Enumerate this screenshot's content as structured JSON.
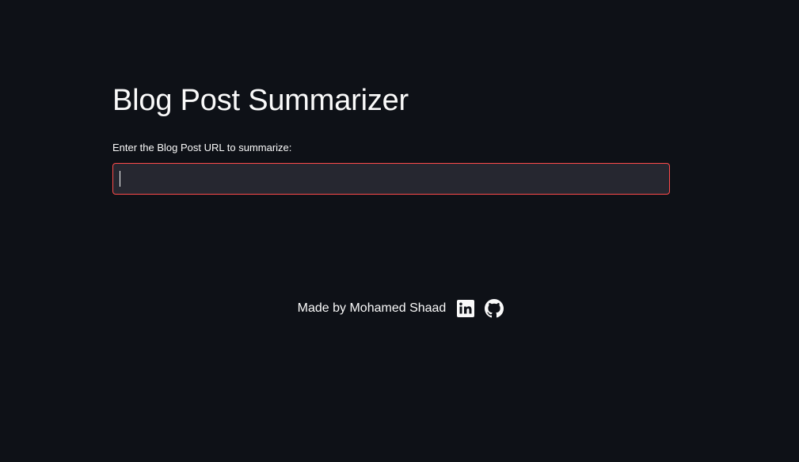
{
  "app": {
    "title": "Blog Post Summarizer"
  },
  "form": {
    "url_label": "Enter the Blog Post URL to summarize:",
    "url_value": "",
    "url_placeholder": ""
  },
  "footer": {
    "credit": "Made by Mohamed Shaad",
    "links": [
      {
        "icon": "linkedin-icon"
      },
      {
        "icon": "github-icon"
      }
    ]
  },
  "colors": {
    "background": "#0e1117",
    "input_background": "#262730",
    "input_focus_border": "#ff4b4b",
    "text": "#fafafa"
  }
}
